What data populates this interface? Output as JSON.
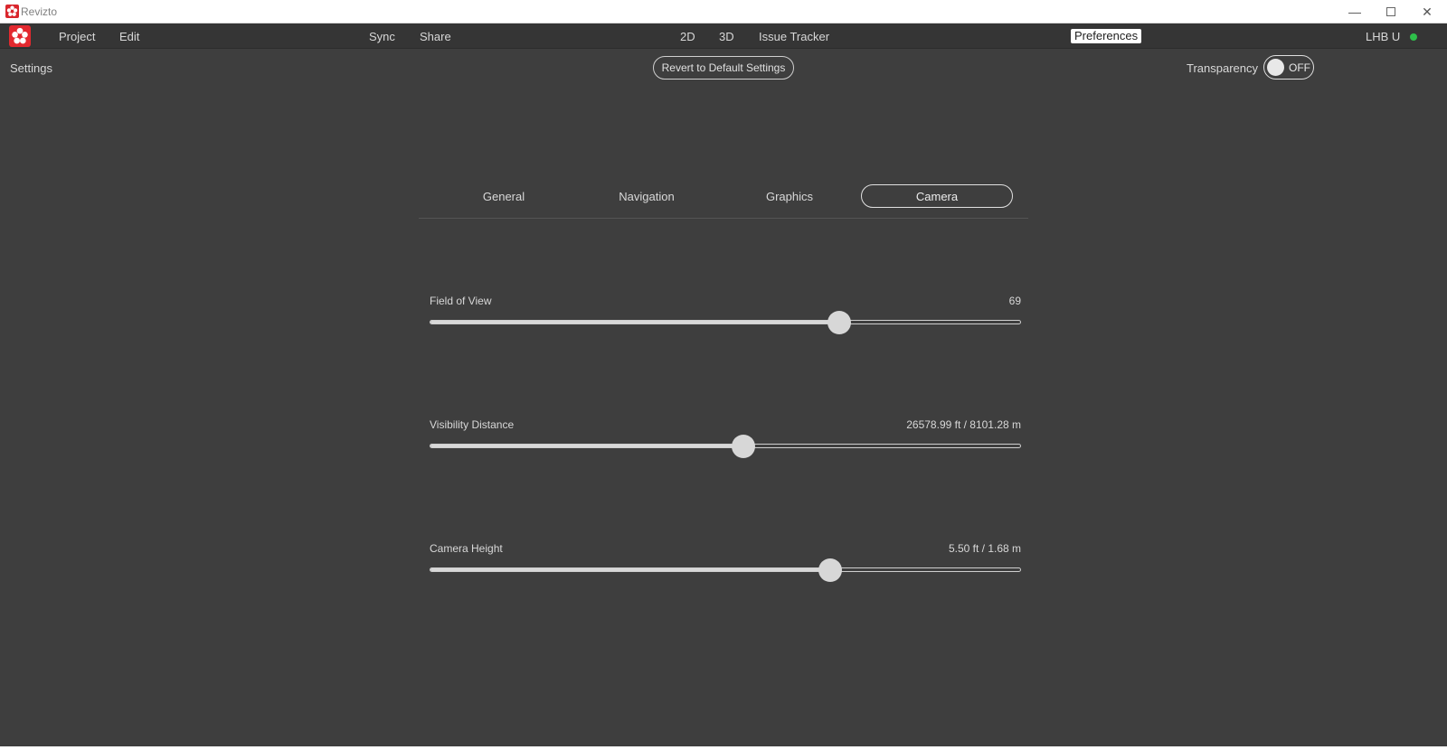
{
  "window": {
    "title": "Revizto"
  },
  "menubar": {
    "project": "Project",
    "edit": "Edit",
    "sync": "Sync",
    "share": "Share",
    "view_2d": "2D",
    "view_3d": "3D",
    "issue_tracker": "Issue Tracker",
    "preferences": "Preferences",
    "user": "LHB U",
    "status_color": "#2ebf4a"
  },
  "toolbar": {
    "settings_label": "Settings",
    "revert_label": "Revert to Default Settings",
    "transparency_label": "Transparency",
    "transparency_state": "OFF"
  },
  "tabs": [
    {
      "label": "General",
      "active": false
    },
    {
      "label": "Navigation",
      "active": false
    },
    {
      "label": "Graphics",
      "active": false
    },
    {
      "label": "Camera",
      "active": true
    }
  ],
  "sliders": [
    {
      "label": "Field of View",
      "value": "69",
      "fraction": 0.693
    },
    {
      "label": "Visibility Distance",
      "value": "26578.99 ft / 8101.28 m",
      "fraction": 0.53
    },
    {
      "label": "Camera Height",
      "value": "5.50 ft / 1.68 m",
      "fraction": 0.677
    }
  ],
  "colors": {
    "background": "#3e3e3e",
    "menubar": "#353535",
    "accent": "#e3292f"
  }
}
